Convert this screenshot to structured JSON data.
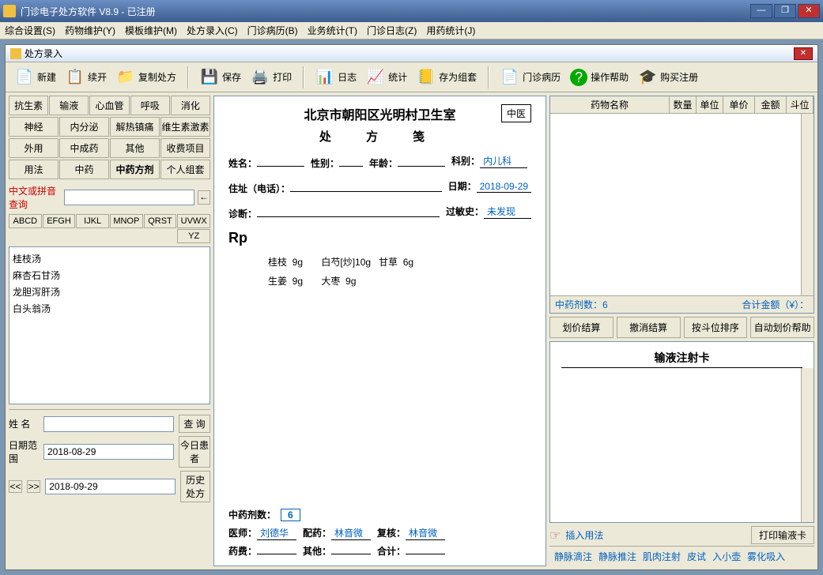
{
  "titlebar": {
    "title": "门诊电子处方软件 V8.9 - 已注册"
  },
  "menubar": [
    "综合设置(S)",
    "药物维护(Y)",
    "模板维护(M)",
    "处方录入(C)",
    "门诊病历(B)",
    "业务统计(T)",
    "门诊日志(Z)",
    "用药统计(J)"
  ],
  "inner": {
    "title": "处方录入"
  },
  "toolbar": {
    "new": "新建",
    "reopen": "续开",
    "copy": "复制处方",
    "save": "保存",
    "print": "打印",
    "log": "日志",
    "stat": "统计",
    "saveset": "存为组套",
    "history": "门诊病历",
    "help": "操作帮助",
    "buy": "购买注册"
  },
  "tabs_row1": [
    "抗生素",
    "输液",
    "心血管",
    "呼吸",
    "消化"
  ],
  "tabs_row2": [
    "神经",
    "内分泌",
    "解热镇痛",
    "维生素激素",
    ""
  ],
  "tabs_row3": [
    "外用",
    "中成药",
    "其他",
    "收费项目",
    ""
  ],
  "tabs_row4": [
    "用法",
    "中药",
    "中药方剂",
    "个人组套",
    ""
  ],
  "search": {
    "label": "中文或拼音查询",
    "arrow": "←"
  },
  "alpha": [
    "ABCD",
    "EFGH",
    "IJKL",
    "MNOP",
    "QRST",
    "UVWX",
    "YZ"
  ],
  "formulas": [
    "桂枝汤",
    "麻杏石甘汤",
    "龙胆泻肝汤",
    "白头翁汤"
  ],
  "query": {
    "name_label": "姓   名",
    "search_btn": "查   询",
    "date_label": "日期范围",
    "date_from": "2018-08-29",
    "today_btn": "今日患者",
    "date_to": "2018-09-29",
    "history_btn": "历史处方",
    "nav_prev": "<<",
    "nav_next": ">>"
  },
  "rx": {
    "hospital": "北京市朝阳区光明村卫生室",
    "title": "处   方   笺",
    "tcm": "中医",
    "name_l": "姓名：",
    "gender_l": "性别：",
    "age_l": "年龄：",
    "dept_l": "科别：",
    "dept_v": "内儿科",
    "addr_l": "住址（电话）：",
    "date_l": "日期：",
    "date_v": "2018-09-29",
    "diag_l": "诊断：",
    "allergy_l": "过敏史：",
    "allergy_v": "未发现",
    "rp": "Rp",
    "line1": "桂枝  9g       白芍[炒]10g   甘草  6g",
    "line2": "生姜  9g       大枣  9g",
    "dose_l": "中药剂数：",
    "dose_v": "6",
    "doctor_l": "医师：",
    "doctor_v": "刘德华",
    "dispense_l": "配药：",
    "dispense_v": "林音微",
    "check_l": "复核：",
    "check_v": "林音微",
    "fee_l": "药费：",
    "other_l": "其他：",
    "total_l": "合计："
  },
  "drugtable": {
    "cols": [
      "药物名称",
      "数量",
      "单位",
      "单价",
      "金额",
      "斗位"
    ],
    "foot_l": "中药剂数：6",
    "foot_r": "合计金额（¥）："
  },
  "actions": {
    "price": "划价结算",
    "cancel": "撤消结算",
    "sort": "按斗位排序",
    "help": "自动划价帮助"
  },
  "infusion": {
    "title": "输液注射卡",
    "insert": "插入用法",
    "print": "打印输液卡"
  },
  "routes": [
    "静脉滴注",
    "静脉推注",
    "肌肉注射",
    "皮试",
    "入小壶",
    "雾化吸入"
  ]
}
